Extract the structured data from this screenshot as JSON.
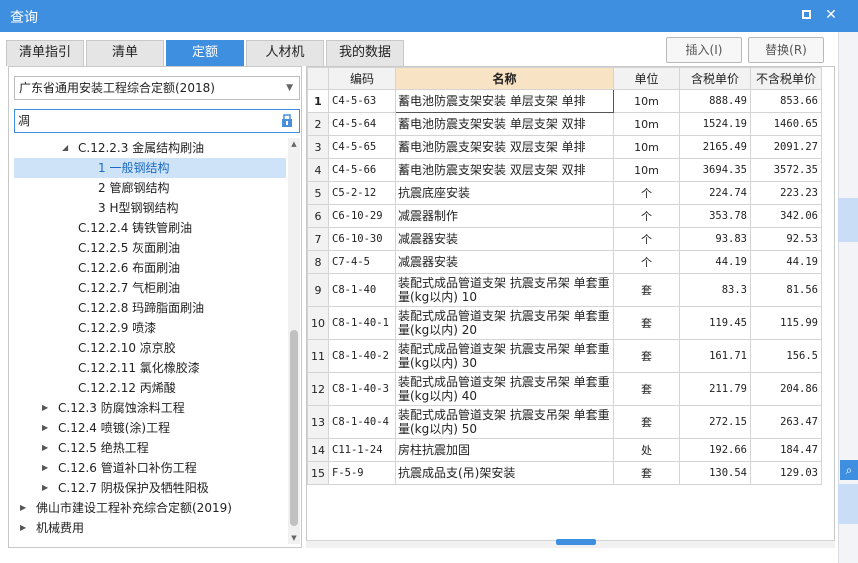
{
  "window": {
    "title": "查询",
    "maximize_icon": "maximize-icon",
    "close_glyph": "✕"
  },
  "tabs": [
    {
      "label": "清单指引",
      "active": false
    },
    {
      "label": "清单",
      "active": false
    },
    {
      "label": "定额",
      "active": true
    },
    {
      "label": "人材机",
      "active": false
    },
    {
      "label": "我的数据",
      "active": false
    }
  ],
  "actions": {
    "insert_label": "插入(I)",
    "replace_label": "替换(R)"
  },
  "left": {
    "library": "广东省通用安装工程综合定额(2018)",
    "search_value": "凋",
    "tree": [
      {
        "label": "C.12.2.3 金属结构刷油",
        "expanded": true,
        "selected": false
      },
      {
        "label": "1 一般钢结构",
        "selected": true
      },
      {
        "label": "2 管廊钢结构",
        "selected": false
      },
      {
        "label": "3 H型钢钢结构",
        "selected": false
      },
      {
        "label": "C.12.2.4 铸铁管刷油",
        "selected": false
      },
      {
        "label": "C.12.2.5 灰面刷油",
        "selected": false
      },
      {
        "label": "C.12.2.6 布面刷油",
        "selected": false
      },
      {
        "label": "C.12.2.7 气柜刷油",
        "selected": false
      },
      {
        "label": "C.12.2.8 玛蹄脂面刷油",
        "selected": false
      },
      {
        "label": "C.12.2.9 喷漆",
        "selected": false
      },
      {
        "label": "C.12.2.10 凉京胶",
        "selected": false
      },
      {
        "label": "C.12.2.11 氯化橡胶漆",
        "selected": false
      },
      {
        "label": "C.12.2.12 丙烯酸",
        "selected": false
      },
      {
        "label": "C.12.3 防腐蚀涂料工程",
        "expanded": false,
        "selected": false
      },
      {
        "label": "C.12.4 喷镀(涂)工程",
        "expanded": false,
        "selected": false
      },
      {
        "label": "C.12.5 绝热工程",
        "expanded": false,
        "selected": false
      },
      {
        "label": "C.12.6 管道补口补伤工程",
        "expanded": false,
        "selected": false
      },
      {
        "label": "C.12.7 阴极保护及牺牲阳极",
        "expanded": false,
        "selected": false
      },
      {
        "label": "佛山市建设工程补充综合定额(2019)",
        "expanded": false,
        "selected": false
      },
      {
        "label": "机械费用",
        "expanded": false,
        "selected": false
      }
    ]
  },
  "table": {
    "headers": [
      "编码",
      "名称",
      "单位",
      "含税单价",
      "不含税单价"
    ],
    "rows": [
      {
        "idx": "1",
        "code": "C4-5-63",
        "name": "蓄电池防震支架安装 单层支架 单排",
        "unit": "10m",
        "tax_price": "888.49",
        "notax_price": "853.66"
      },
      {
        "idx": "2",
        "code": "C4-5-64",
        "name": "蓄电池防震支架安装 单层支架 双排",
        "unit": "10m",
        "tax_price": "1524.19",
        "notax_price": "1460.65"
      },
      {
        "idx": "3",
        "code": "C4-5-65",
        "name": "蓄电池防震支架安装 双层支架 单排",
        "unit": "10m",
        "tax_price": "2165.49",
        "notax_price": "2091.27"
      },
      {
        "idx": "4",
        "code": "C4-5-66",
        "name": "蓄电池防震支架安装 双层支架 双排",
        "unit": "10m",
        "tax_price": "3694.35",
        "notax_price": "3572.35"
      },
      {
        "idx": "5",
        "code": "C5-2-12",
        "name": "抗震底座安装",
        "unit": "个",
        "tax_price": "224.74",
        "notax_price": "223.23"
      },
      {
        "idx": "6",
        "code": "C6-10-29",
        "name": "减震器制作",
        "unit": "个",
        "tax_price": "353.78",
        "notax_price": "342.06"
      },
      {
        "idx": "7",
        "code": "C6-10-30",
        "name": "减震器安装",
        "unit": "个",
        "tax_price": "93.83",
        "notax_price": "92.53"
      },
      {
        "idx": "8",
        "code": "C7-4-5",
        "name": "减震器安装",
        "unit": "个",
        "tax_price": "44.19",
        "notax_price": "44.19"
      },
      {
        "idx": "9",
        "code": "C8-1-40",
        "name": "装配式成品管道支架 抗震支吊架 单套重量(kg以内) 10",
        "unit": "套",
        "tax_price": "83.3",
        "notax_price": "81.56"
      },
      {
        "idx": "10",
        "code": "C8-1-40-1",
        "name": "装配式成品管道支架 抗震支吊架 单套重量(kg以内) 20",
        "unit": "套",
        "tax_price": "119.45",
        "notax_price": "115.99"
      },
      {
        "idx": "11",
        "code": "C8-1-40-2",
        "name": "装配式成品管道支架 抗震支吊架 单套重量(kg以内) 30",
        "unit": "套",
        "tax_price": "161.71",
        "notax_price": "156.5"
      },
      {
        "idx": "12",
        "code": "C8-1-40-3",
        "name": "装配式成品管道支架 抗震支吊架 单套重量(kg以内) 40",
        "unit": "套",
        "tax_price": "211.79",
        "notax_price": "204.86"
      },
      {
        "idx": "13",
        "code": "C8-1-40-4",
        "name": "装配式成品管道支架 抗震支吊架 单套重量(kg以内) 50",
        "unit": "套",
        "tax_price": "272.15",
        "notax_price": "263.47"
      },
      {
        "idx": "14",
        "code": "C11-1-24",
        "name": "房柱抗震加固",
        "unit": "处",
        "tax_price": "192.66",
        "notax_price": "184.47"
      },
      {
        "idx": "15",
        "code": "F-5-9",
        "name": "抗震成品支(吊)架安装",
        "unit": "套",
        "tax_price": "130.54",
        "notax_price": "129.03"
      }
    ]
  },
  "colors": {
    "accent": "#3f8fe0",
    "selected_row": "#cfe3f8",
    "name_header": "#f8e3c4"
  }
}
